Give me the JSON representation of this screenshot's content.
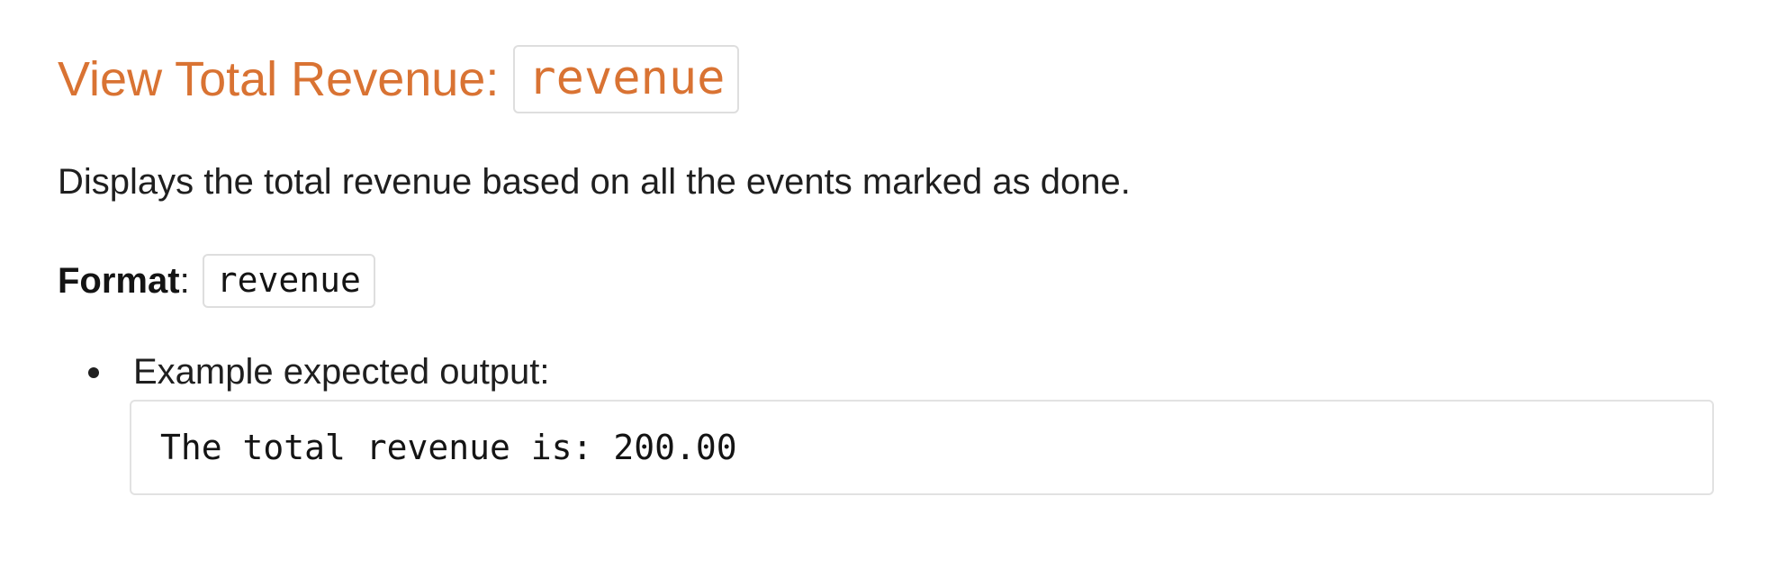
{
  "section": {
    "title": "View Total Revenue:",
    "command_code": "revenue",
    "description": "Displays the total revenue based on all the events marked as done.",
    "format_label": "Format",
    "format_colon": ":",
    "format_code": "revenue",
    "list": [
      {
        "text": "Example expected output:",
        "code_block": "The total revenue is: 200.00"
      }
    ]
  },
  "colors": {
    "heading": "#d97333",
    "text": "#1f1f1f",
    "code_border": "#dedede"
  }
}
